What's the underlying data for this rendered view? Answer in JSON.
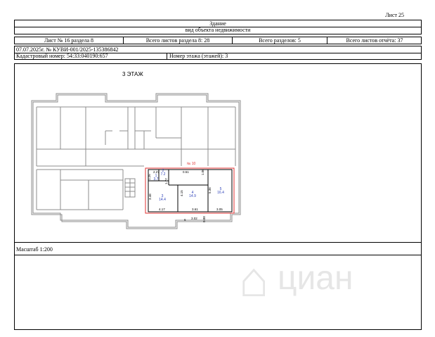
{
  "header": {
    "sheet_label": "Лист 25",
    "object_title": "Здание",
    "object_subtitle": "вид объекта недвижимости"
  },
  "info_row": {
    "sheet_of_section": "Лист № 16 раздела 8",
    "total_sheets_section": "Всего листов раздела 8: 28",
    "total_sections": "Всего разделов: 5",
    "total_sheets_report": "Всего листов отчёта: 37"
  },
  "record": {
    "date_number": "07.07.2025г. № КУВИ-001/2025-135386842",
    "cadastral_number": "Кадастровый номер: 54:33:040190:657",
    "floor_number": "Номер этажа (этажей): 3"
  },
  "plan": {
    "floor_title": "3 ЭТАЖ",
    "unit_label": "№ 10",
    "dimensions": [
      "2.27",
      "0.51",
      "1.06",
      "1.26",
      "1.77",
      "3.46",
      "4.15",
      "5.36",
      "4.17",
      "3.61",
      "3.05",
      "3.02",
      "6",
      "0.88"
    ],
    "rooms": [
      {
        "num": "1",
        "area": "3.7"
      },
      {
        "num": "2",
        "area": "7.2"
      },
      {
        "num": "3",
        "area": "14.4"
      },
      {
        "num": "4",
        "area": "14.9"
      },
      {
        "num": "5",
        "area": "16.4"
      }
    ]
  },
  "footer": {
    "scale": "Масштаб 1:200"
  },
  "watermark": {
    "text": "циан"
  },
  "colors": {
    "wall": "#8c8c8c",
    "unit_outline": "#e03030",
    "room_number": "#2b3fb8"
  }
}
